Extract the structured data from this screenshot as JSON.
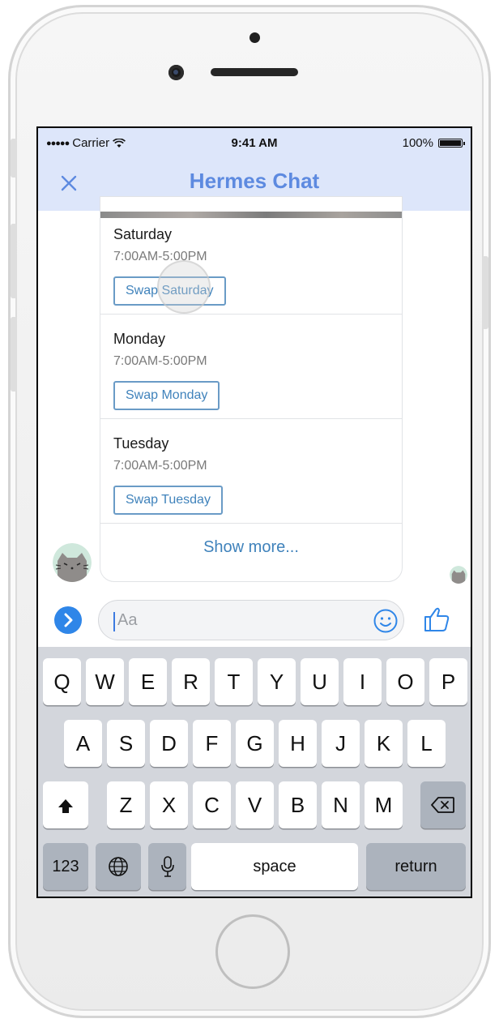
{
  "status_bar": {
    "carrier": "Carrier",
    "signal_dots": "●●●●●",
    "time": "9:41 AM",
    "battery": "100%"
  },
  "nav": {
    "title": "Hermes Chat",
    "close_icon": "close-icon"
  },
  "schedule": [
    {
      "day": "Saturday",
      "hours": "7:00AM-5:00PM",
      "button": "Swap Saturday"
    },
    {
      "day": "Monday",
      "hours": "7:00AM-5:00PM",
      "button": "Swap Monday"
    },
    {
      "day": "Tuesday",
      "hours": "7:00AM-5:00PM",
      "button": "Swap Tuesday"
    }
  ],
  "show_more": "Show more...",
  "composer": {
    "placeholder": "Aa"
  },
  "keyboard": {
    "row1": [
      "Q",
      "W",
      "E",
      "R",
      "T",
      "Y",
      "U",
      "I",
      "O",
      "P"
    ],
    "row2": [
      "A",
      "S",
      "D",
      "F",
      "G",
      "H",
      "J",
      "K",
      "L"
    ],
    "row3": [
      "Z",
      "X",
      "C",
      "V",
      "B",
      "N",
      "M"
    ],
    "numbers": "123",
    "space": "space",
    "return": "return"
  },
  "colors": {
    "header_bg": "#dde6fa",
    "title": "#5d8ae0",
    "link": "#3f82bb",
    "messenger_blue": "#2f86e8"
  }
}
